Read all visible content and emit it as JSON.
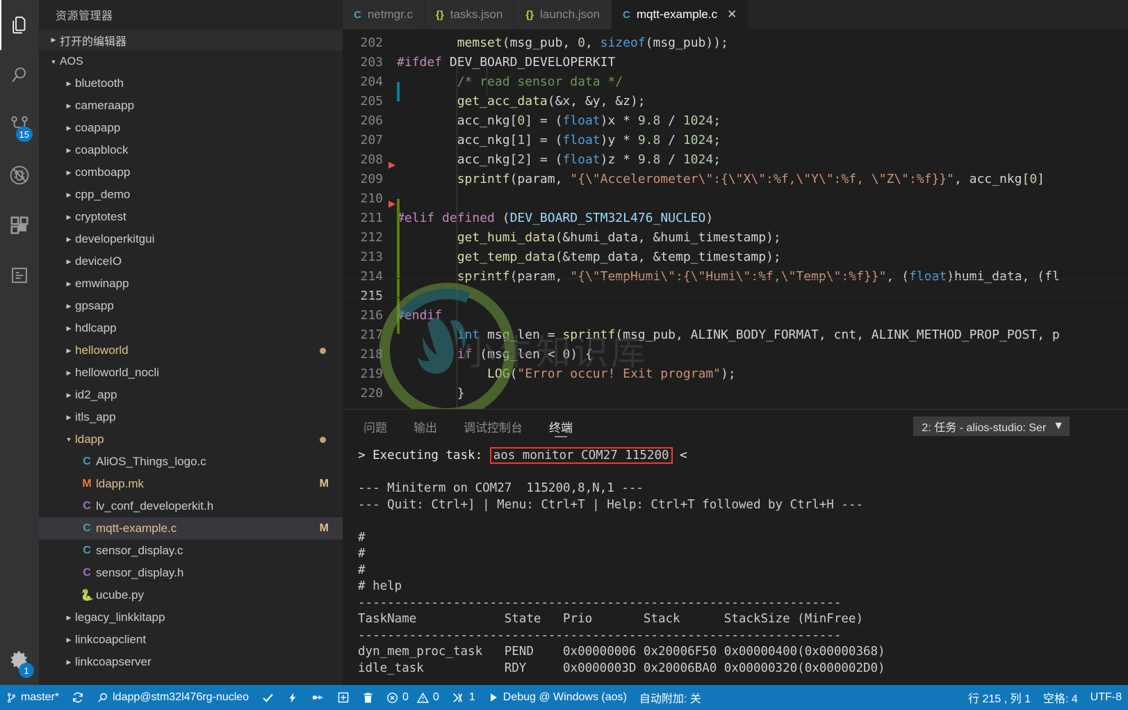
{
  "activitybar": {
    "items": [
      {
        "name": "explorer-icon",
        "title": "资源管理器",
        "active": true,
        "badge": null
      },
      {
        "name": "search-icon",
        "title": "搜索",
        "active": false,
        "badge": null
      },
      {
        "name": "source-control-icon",
        "title": "源代码管理",
        "active": false,
        "badge": "15"
      },
      {
        "name": "run-debug-icon",
        "title": "调试",
        "active": false,
        "badge": null
      },
      {
        "name": "extensions-icon",
        "title": "扩展",
        "active": false,
        "badge": null
      },
      {
        "name": "remote-explorer-icon",
        "title": "远程资源管理器",
        "active": false,
        "badge": null
      }
    ],
    "manage": {
      "name": "settings-gear-icon",
      "badge": "1"
    }
  },
  "sidebar": {
    "title": "资源管理器",
    "open_editors_label": "打开的编辑器",
    "workspace_label": "AOS",
    "tree": [
      {
        "label": "bluetooth",
        "type": "folder",
        "depth": 1,
        "expanded": false
      },
      {
        "label": "cameraapp",
        "type": "folder",
        "depth": 1,
        "expanded": false
      },
      {
        "label": "coapapp",
        "type": "folder",
        "depth": 1,
        "expanded": false
      },
      {
        "label": "coapblock",
        "type": "folder",
        "depth": 1,
        "expanded": false
      },
      {
        "label": "comboapp",
        "type": "folder",
        "depth": 1,
        "expanded": false
      },
      {
        "label": "cpp_demo",
        "type": "folder",
        "depth": 1,
        "expanded": false
      },
      {
        "label": "cryptotest",
        "type": "folder",
        "depth": 1,
        "expanded": false
      },
      {
        "label": "developerkitgui",
        "type": "folder",
        "depth": 1,
        "expanded": false
      },
      {
        "label": "deviceIO",
        "type": "folder",
        "depth": 1,
        "expanded": false
      },
      {
        "label": "emwinapp",
        "type": "folder",
        "depth": 1,
        "expanded": false
      },
      {
        "label": "gpsapp",
        "type": "folder",
        "depth": 1,
        "expanded": false
      },
      {
        "label": "hdlcapp",
        "type": "folder",
        "depth": 1,
        "expanded": false
      },
      {
        "label": "helloworld",
        "type": "folder",
        "depth": 1,
        "expanded": false,
        "modified": true,
        "dot": true
      },
      {
        "label": "helloworld_nocli",
        "type": "folder",
        "depth": 1,
        "expanded": false
      },
      {
        "label": "id2_app",
        "type": "folder",
        "depth": 1,
        "expanded": false
      },
      {
        "label": "itls_app",
        "type": "folder",
        "depth": 1,
        "expanded": false
      },
      {
        "label": "ldapp",
        "type": "folder",
        "depth": 1,
        "expanded": true,
        "modified": true,
        "dot": true
      },
      {
        "label": "AliOS_Things_logo.c",
        "type": "c",
        "depth": 2
      },
      {
        "label": "ldapp.mk",
        "type": "mk",
        "depth": 2,
        "modified": true,
        "badge": "M"
      },
      {
        "label": "lv_conf_developerkit.h",
        "type": "h",
        "depth": 2
      },
      {
        "label": "mqtt-example.c",
        "type": "c",
        "depth": 2,
        "modified": true,
        "badge": "M",
        "selected": true
      },
      {
        "label": "sensor_display.c",
        "type": "c",
        "depth": 2
      },
      {
        "label": "sensor_display.h",
        "type": "h",
        "depth": 2
      },
      {
        "label": "ucube.py",
        "type": "py",
        "depth": 2
      },
      {
        "label": "legacy_linkkitapp",
        "type": "folder",
        "depth": 1,
        "expanded": false
      },
      {
        "label": "linkcoapclient",
        "type": "folder",
        "depth": 1,
        "expanded": false
      },
      {
        "label": "linkcoapserver",
        "type": "folder",
        "depth": 1,
        "expanded": false
      }
    ]
  },
  "tabs": [
    {
      "label": "netmgr.c",
      "icon": "c-file-icon",
      "icon_text": "C",
      "active": false
    },
    {
      "label": "tasks.json",
      "icon": "json-file-icon",
      "icon_text": "{}",
      "active": false
    },
    {
      "label": "launch.json",
      "icon": "json-file-icon",
      "icon_text": "{}",
      "active": false
    },
    {
      "label": "mqtt-example.c",
      "icon": "c-file-icon",
      "icon_text": "C",
      "active": true,
      "close": "✕"
    }
  ],
  "editor": {
    "first_line": 202,
    "current_line": 215,
    "watermark_text": "小牛知识库",
    "lines": [
      {
        "n": 202,
        "html": "        <span class=\"fn\">memset</span><span class=\"plain\">(msg_pub, </span><span class=\"num\">0</span><span class=\"plain\">, </span><span class=\"kw2\">sizeof</span><span class=\"plain\">(msg_pub));</span>"
      },
      {
        "n": 203,
        "html": "<span class=\"kw\">#ifdef</span><span class=\"macro\"> DEV_BOARD_DEVELOPERKIT</span>"
      },
      {
        "n": 204,
        "html": "        <span class=\"cmt\">/* read sensor data */</span>"
      },
      {
        "n": 205,
        "html": "        <span class=\"fn\">get_acc_data</span><span class=\"plain\">(&amp;x, &amp;y, &amp;z);</span>"
      },
      {
        "n": 206,
        "html": "        <span class=\"plain\">acc_nkg[</span><span class=\"num\">0</span><span class=\"plain\">] = (</span><span class=\"kw2\">float</span><span class=\"plain\">)x * </span><span class=\"num\">9.8</span><span class=\"plain\"> / </span><span class=\"num\">1024</span><span class=\"plain\">;</span>"
      },
      {
        "n": 207,
        "html": "        <span class=\"plain\">acc_nkg[</span><span class=\"num\">1</span><span class=\"plain\">] = (</span><span class=\"kw2\">float</span><span class=\"plain\">)y * </span><span class=\"num\">9.8</span><span class=\"plain\"> / </span><span class=\"num\">1024</span><span class=\"plain\">;</span>"
      },
      {
        "n": 208,
        "html": "        <span class=\"plain\">acc_nkg[</span><span class=\"num\">2</span><span class=\"plain\">] = (</span><span class=\"kw2\">float</span><span class=\"plain\">)z * </span><span class=\"num\">9.8</span><span class=\"plain\"> / </span><span class=\"num\">1024</span><span class=\"plain\">;</span>"
      },
      {
        "n": 209,
        "html": "        <span class=\"fn\">sprintf</span><span class=\"plain\">(param, </span><span class=\"str\">\"{\\\"Accelerometer\\\":{\\\"X\\\":%f,\\\"Y\\\":%f, \\\"Z\\\":%f}}\"</span><span class=\"plain\">, acc_nkg[</span><span class=\"num\">0</span><span class=\"plain\">]</span>"
      },
      {
        "n": 210,
        "html": ""
      },
      {
        "n": 211,
        "html": "<span class=\"kw\">#elif defined</span><span class=\"plain\"> (</span><span class=\"var\">DEV_BOARD_STM32L476_NUCLEO</span><span class=\"plain\">)</span>"
      },
      {
        "n": 212,
        "html": "        <span class=\"fn\">get_humi_data</span><span class=\"plain\">(&amp;humi_data, &amp;humi_timestamp);</span>"
      },
      {
        "n": 213,
        "html": "        <span class=\"fn\">get_temp_data</span><span class=\"plain\">(&amp;temp_data, &amp;temp_timestamp);</span>"
      },
      {
        "n": 214,
        "html": "        <span class=\"fn\">sprintf</span><span class=\"plain\">(param, </span><span class=\"str\">\"{\\\"TempHumi\\\":{\\\"Humi\\\":%f,\\\"Temp\\\":%f}}\"</span><span class=\"plain\">, (</span><span class=\"kw2\">float</span><span class=\"plain\">)humi_data, (fl</span>"
      },
      {
        "n": 215,
        "html": ""
      },
      {
        "n": 216,
        "html": "<span class=\"kw\">#endif</span>"
      },
      {
        "n": 217,
        "html": "        <span class=\"kw2\">int</span><span class=\"plain\"> msg_len = </span><span class=\"fn\">sprintf</span><span class=\"plain\">(msg_pub, ALINK_BODY_FORMAT, cnt, ALINK_METHOD_PROP_POST, p</span>"
      },
      {
        "n": 218,
        "html": "        <span class=\"kw\">if</span><span class=\"plain\"> (msg_len &lt; </span><span class=\"num\">0</span><span class=\"plain\">) {</span>"
      },
      {
        "n": 219,
        "html": "            <span class=\"fn\">LOG</span><span class=\"plain\">(</span><span class=\"str\">\"Error occur! Exit program\"</span><span class=\"plain\">);</span>"
      },
      {
        "n": 220,
        "html": "        <span class=\"plain\">}</span>"
      }
    ]
  },
  "panel": {
    "tabs": [
      {
        "label": "问题",
        "active": false
      },
      {
        "label": "输出",
        "active": false
      },
      {
        "label": "调试控制台",
        "active": false
      },
      {
        "label": "终端",
        "active": true
      }
    ],
    "task_selector": "2: 任务 - alios-studio: Ser",
    "task_selector_caret": "▼",
    "terminal": {
      "exec_prefix": "> Executing task: ",
      "exec_command": "aos monitor COM27 115200",
      "exec_suffix": " <",
      "lines": [
        "",
        "--- Miniterm on COM27  115200,8,N,1 ---",
        "--- Quit: Ctrl+] | Menu: Ctrl+T | Help: Ctrl+T followed by Ctrl+H ---",
        "",
        "#",
        "#",
        "#",
        "# help",
        "------------------------------------------------------------------",
        "TaskName            State   Prio       Stack      StackSize (MinFree)",
        "------------------------------------------------------------------",
        "dyn_mem_proc_task   PEND    0x00000006 0x20006F50 0x00000400(0x00000368)",
        "idle_task           RDY     0x0000003D 0x20006BA0 0x00000320(0x000002D0)"
      ]
    }
  },
  "statusbar": {
    "branch": "master*",
    "sync_icon": "sync-icon",
    "search_icon": "search-icon",
    "target": "ldapp@stm32l476rg-nucleo",
    "check_icon": "check-icon",
    "flash_icon": "lightning-icon",
    "plug_icon": "plug-icon",
    "add_icon": "add-box-icon",
    "trash_icon": "trash-icon",
    "errors_icon": "error-icon",
    "errors": "0",
    "warnings_icon": "warning-icon",
    "warnings": "0",
    "ports_icon": "ports-icon",
    "ports": "1",
    "debug_icon": "play-icon",
    "debug_label": "Debug @ Windows (aos)",
    "auto_attach": "自动附加: 关",
    "cursor_position": "行 215 , 列 1",
    "indentation": "空格: 4",
    "encoding": "UTF-8"
  },
  "colors": {
    "accent": "#1177bb",
    "badge": "#0e7ac4",
    "modified": "#e2c08d",
    "highlight_box": "#f03a3a"
  }
}
